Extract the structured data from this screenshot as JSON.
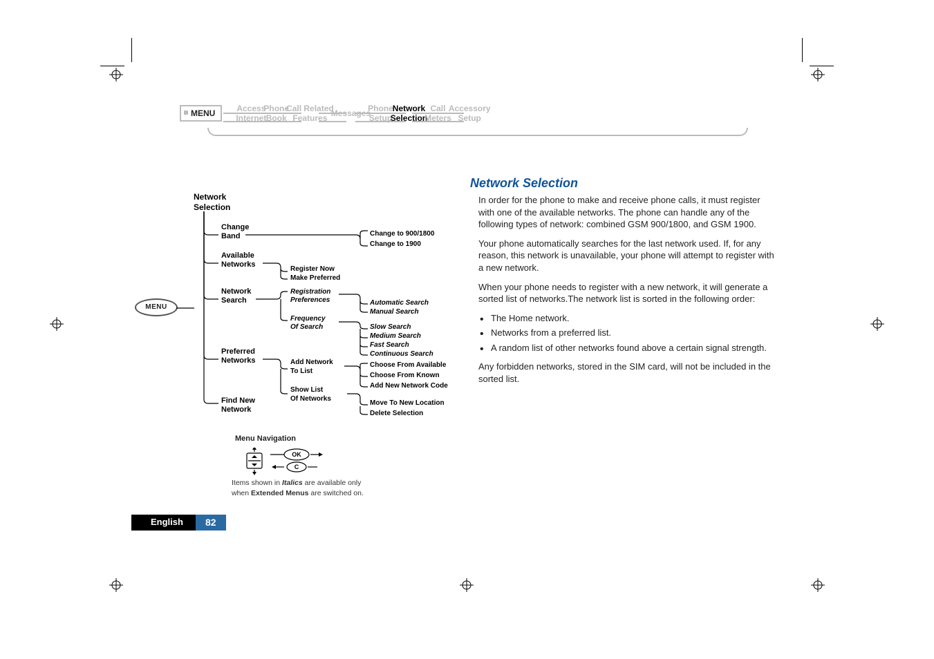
{
  "nav": {
    "menu_label": "MENU",
    "items": [
      {
        "l1": "Access",
        "l2": "Internet",
        "bold": false
      },
      {
        "l1": "Phone",
        "l2": "Book",
        "bold": false
      },
      {
        "l1": "Call Related",
        "l2": "Features",
        "bold": false
      },
      {
        "l1": "Messages",
        "l2": "",
        "bold": false
      },
      {
        "l1": "Phone",
        "l2": "Setup",
        "bold": false
      },
      {
        "l1": "Network",
        "l2": "Selection",
        "bold": true
      },
      {
        "l1": "Call",
        "l2": "Meters",
        "bold": false
      },
      {
        "l1": "Accessory",
        "l2": "Setup",
        "bold": false
      }
    ]
  },
  "left_menu_oval": "MENU",
  "diagram": {
    "root": {
      "l1": "Network",
      "l2": "Selection"
    },
    "menu_nav_label": "Menu Navigation",
    "key_ok": "OK",
    "key_c": "C",
    "note_before_italics": "Items shown in ",
    "note_italics": "Italics",
    "note_mid": " are available only",
    "note_l2_before_bold": "when ",
    "note_bold": "Extended Menus",
    "note_after_bold": " are switched on.",
    "tree": {
      "change_band": {
        "label_l1": "Change",
        "label_l2": "Band",
        "opts": [
          "Change to 900/1800",
          "Change to 1900"
        ]
      },
      "available_networks": {
        "label_l1": "Available",
        "label_l2": "Networks",
        "opts": [
          "Register Now",
          "Make Preferred"
        ]
      },
      "network_search": {
        "label_l1": "Network",
        "label_l2": "Search",
        "reg_pref": {
          "label_l1": "Registration",
          "label_l2": "Preferences",
          "opts": [
            "Automatic Search",
            "Manual Search"
          ]
        },
        "freq": {
          "label_l1": "Frequency",
          "label_l2": "Of Search",
          "opts": [
            "Slow Search",
            "Medium Search",
            "Fast Search",
            "Continuous Search"
          ]
        }
      },
      "preferred_networks": {
        "label_l1": "Preferred",
        "label_l2": "Networks",
        "add": {
          "label_l1": "Add Network",
          "label_l2": "To List",
          "opts": [
            "Choose From Available",
            "Choose From Known",
            "Add New Network Code"
          ]
        },
        "show": {
          "label_l1": "Show List",
          "label_l2": "Of Networks",
          "opts": [
            "Move To New Location",
            "Delete Selection"
          ]
        }
      },
      "find_new": {
        "label_l1": "Find New",
        "label_l2": "Network"
      }
    }
  },
  "right": {
    "heading": "Network Selection",
    "p1": "In order for the phone to make and receive phone calls, it must register with one of the available networks. The phone can handle any of the following types of network: combined GSM 900/1800, and GSM 1900.",
    "p2": "Your phone automatically searches for the last network used. If, for any reason, this network is unavailable, your phone will attempt to register with a new network.",
    "p3": "When your phone needs to register with a new network, it will generate a sorted list of networks.The network list is sorted in the following order:",
    "bullets": [
      "The Home network.",
      "Networks from a preferred list.",
      "A random list of other networks found above a certain signal strength."
    ],
    "p4": "Any forbidden networks, stored in the SIM card, will not be included in the sorted list."
  },
  "footer": {
    "language": "English",
    "page": "82"
  }
}
